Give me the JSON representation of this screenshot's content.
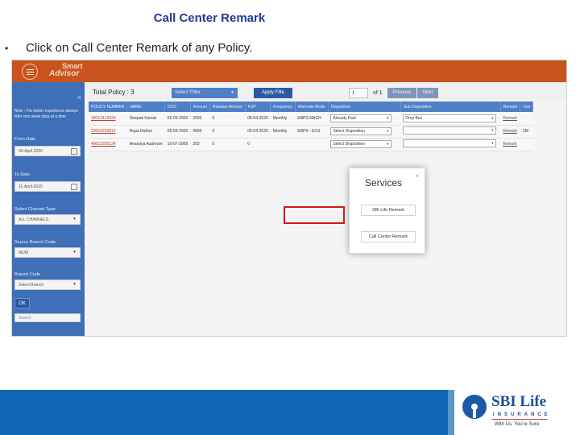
{
  "slide": {
    "title": "Call Center Remark",
    "bullet_symbol": "•",
    "bullet_text": "Click on Call  Center Remark of any Policy."
  },
  "app": {
    "brand_line1": "Smart",
    "brand_line2": "Advisor",
    "sidebar": {
      "close_icon": "×",
      "note": "Note : For better experience always filter one week data at a time",
      "from_date_label": "From Date",
      "from_date_value": "04-April-2020",
      "to_date_label": "To Date",
      "to_date_value": "11-April-2020",
      "channel_label": "Select Channel Type",
      "channel_value": "ALL CHANNELS",
      "source_branch_label": "Source Branch Code",
      "source_branch_value": "MUM",
      "branch_label": "Branch Code",
      "branch_placeholder": "Select Branch",
      "ok_label": "OK",
      "search_placeholder": "Search"
    },
    "toolbar": {
      "total_policy": "Total Policy : 3",
      "select_filter": "Select Filter",
      "apply_filter": "Apply Filte",
      "page_value": "1",
      "page_of": "of 1",
      "previous": "Previous",
      "next": "Next"
    },
    "table": {
      "headers": [
        "POLICY NUMBER",
        "NAME",
        "DOC",
        "Amount",
        "Residue Amount",
        "FUP",
        "Frequency",
        "Alternate Mode",
        "Disposition",
        "Sub Disposition",
        "Remark",
        "Use"
      ],
      "rows": [
        {
          "policy": "30012413029",
          "name": "Deepak Kamat",
          "doc": "05-09-2000",
          "amount": "2000",
          "residue": "0",
          "fup": "05-04-2020",
          "frequency": "Monthly",
          "mode": "EBPS-NACH",
          "disposition": "Already Paid",
          "sub_disposition": "Drop Box",
          "remark": "Remark",
          "use": ""
        },
        {
          "policy": "23015292813",
          "name": "Rupa Rathor",
          "doc": "05-09-2000",
          "amount": "4000",
          "residue": "0",
          "fup": "05-04-2020",
          "frequency": "Monthly",
          "mode": "EBPS - ECS",
          "disposition": "Select Disposition",
          "sub_disposition": "",
          "remark": "Remark",
          "use": "1M"
        },
        {
          "policy": "49013295124",
          "name": "Ananaya Aashram",
          "doc": "10-07-2009",
          "amount": "263",
          "residue": "0",
          "fup": "0",
          "frequency": "",
          "mode": "",
          "disposition": "Select Disposition",
          "sub_disposition": "",
          "remark": "Remark",
          "use": ""
        }
      ]
    },
    "modal": {
      "title": "Services",
      "close_icon": "×",
      "option1": "SBI Life Remark",
      "option2": "Call Center Remark"
    }
  },
  "footer": {
    "logo_name": "SBI Life",
    "logo_insurance": "INSURANCE",
    "tagline": "With Us. You're Sure"
  },
  "colors": {
    "title_blue": "#1f3a93",
    "header_orange": "#c8531f",
    "sidebar_blue": "#3e6fb7",
    "highlight_red": "#d41818",
    "footer_blue": "#0e67b2"
  }
}
